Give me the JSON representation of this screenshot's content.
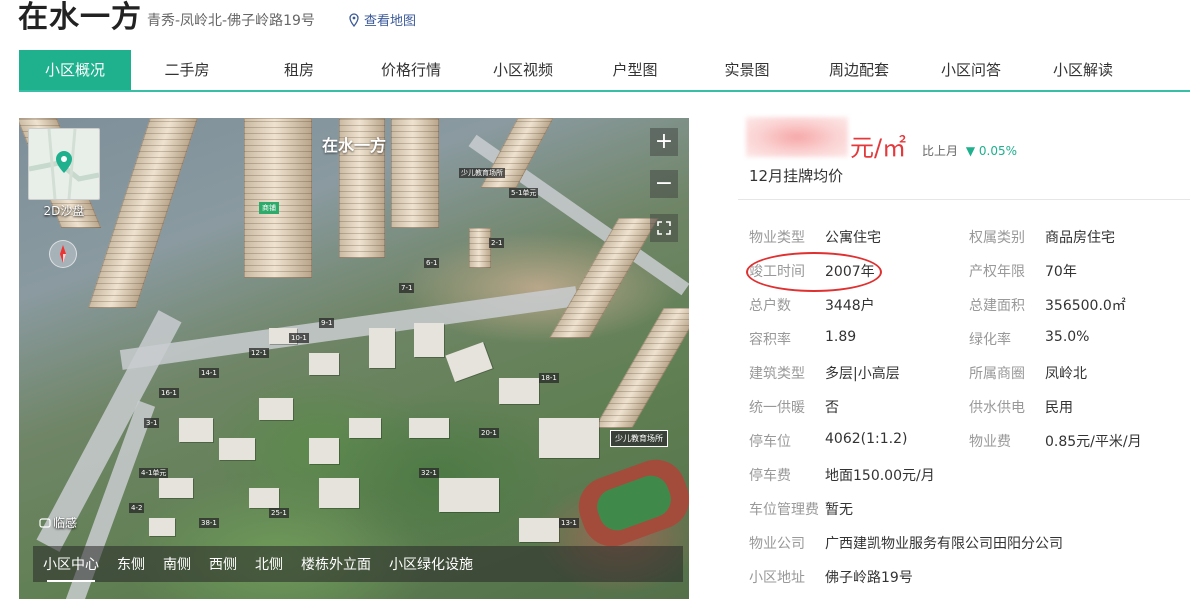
{
  "header": {
    "title": "在水一方",
    "address": "青秀-凤岭北-佛子岭路19号",
    "map_link": "查看地图"
  },
  "tabs": [
    {
      "label": "小区概况",
      "active": true
    },
    {
      "label": "二手房"
    },
    {
      "label": "租房"
    },
    {
      "label": "价格行情"
    },
    {
      "label": "小区视频"
    },
    {
      "label": "户型图"
    },
    {
      "label": "实景图"
    },
    {
      "label": "周边配套"
    },
    {
      "label": "小区问答"
    },
    {
      "label": "小区解读"
    }
  ],
  "panel": {
    "title": "在水一方",
    "thumb_label": "2D沙盘",
    "zoom_in": "+",
    "zoom_out": "−",
    "lingan": "临感",
    "place_tag": "少儿教育场所",
    "green_badge": "商铺",
    "bottom_tabs": [
      "小区中心",
      "东侧",
      "南侧",
      "西侧",
      "北侧",
      "楼栋外立面",
      "小区绿化设施"
    ]
  },
  "price": {
    "unit": "元/㎡",
    "compare_label": "比上月",
    "compare_value": "▼ 0.05%",
    "subtitle": "12月挂牌均价"
  },
  "info": {
    "property_type_label": "物业类型",
    "property_type": "公寓住宅",
    "ownership_label": "权属类别",
    "ownership": "商品房住宅",
    "built_label": "竣工时间",
    "built": "2007年",
    "tenure_label": "产权年限",
    "tenure": "70年",
    "households_label": "总户数",
    "households": "3448户",
    "area_label": "总建面积",
    "area": "356500.0㎡",
    "far_label": "容积率",
    "far": "1.89",
    "green_label": "绿化率",
    "green": "35.0%",
    "building_label": "建筑类型",
    "building": "多层|小高层",
    "district_label": "所属商圈",
    "district": "凤岭北",
    "heating_label": "统一供暖",
    "heating": "否",
    "utility_label": "供水供电",
    "utility": "民用",
    "parking_label": "停车位",
    "parking": "4062(1:1.2)",
    "fee_label": "物业费",
    "fee": "0.85元/平米/月",
    "parking_fee_label": "停车费",
    "parking_fee": "地面150.00元/月",
    "parking_mgmt_label": "车位管理费",
    "parking_mgmt": "暂无",
    "company_label": "物业公司",
    "company": "广西建凯物业服务有限公司田阳分公司",
    "addr_label": "小区地址",
    "addr": "佛子岭路19号"
  },
  "colors": {
    "accent": "#1fb08e",
    "price": "#e4393c",
    "annotation": "#e03030"
  }
}
